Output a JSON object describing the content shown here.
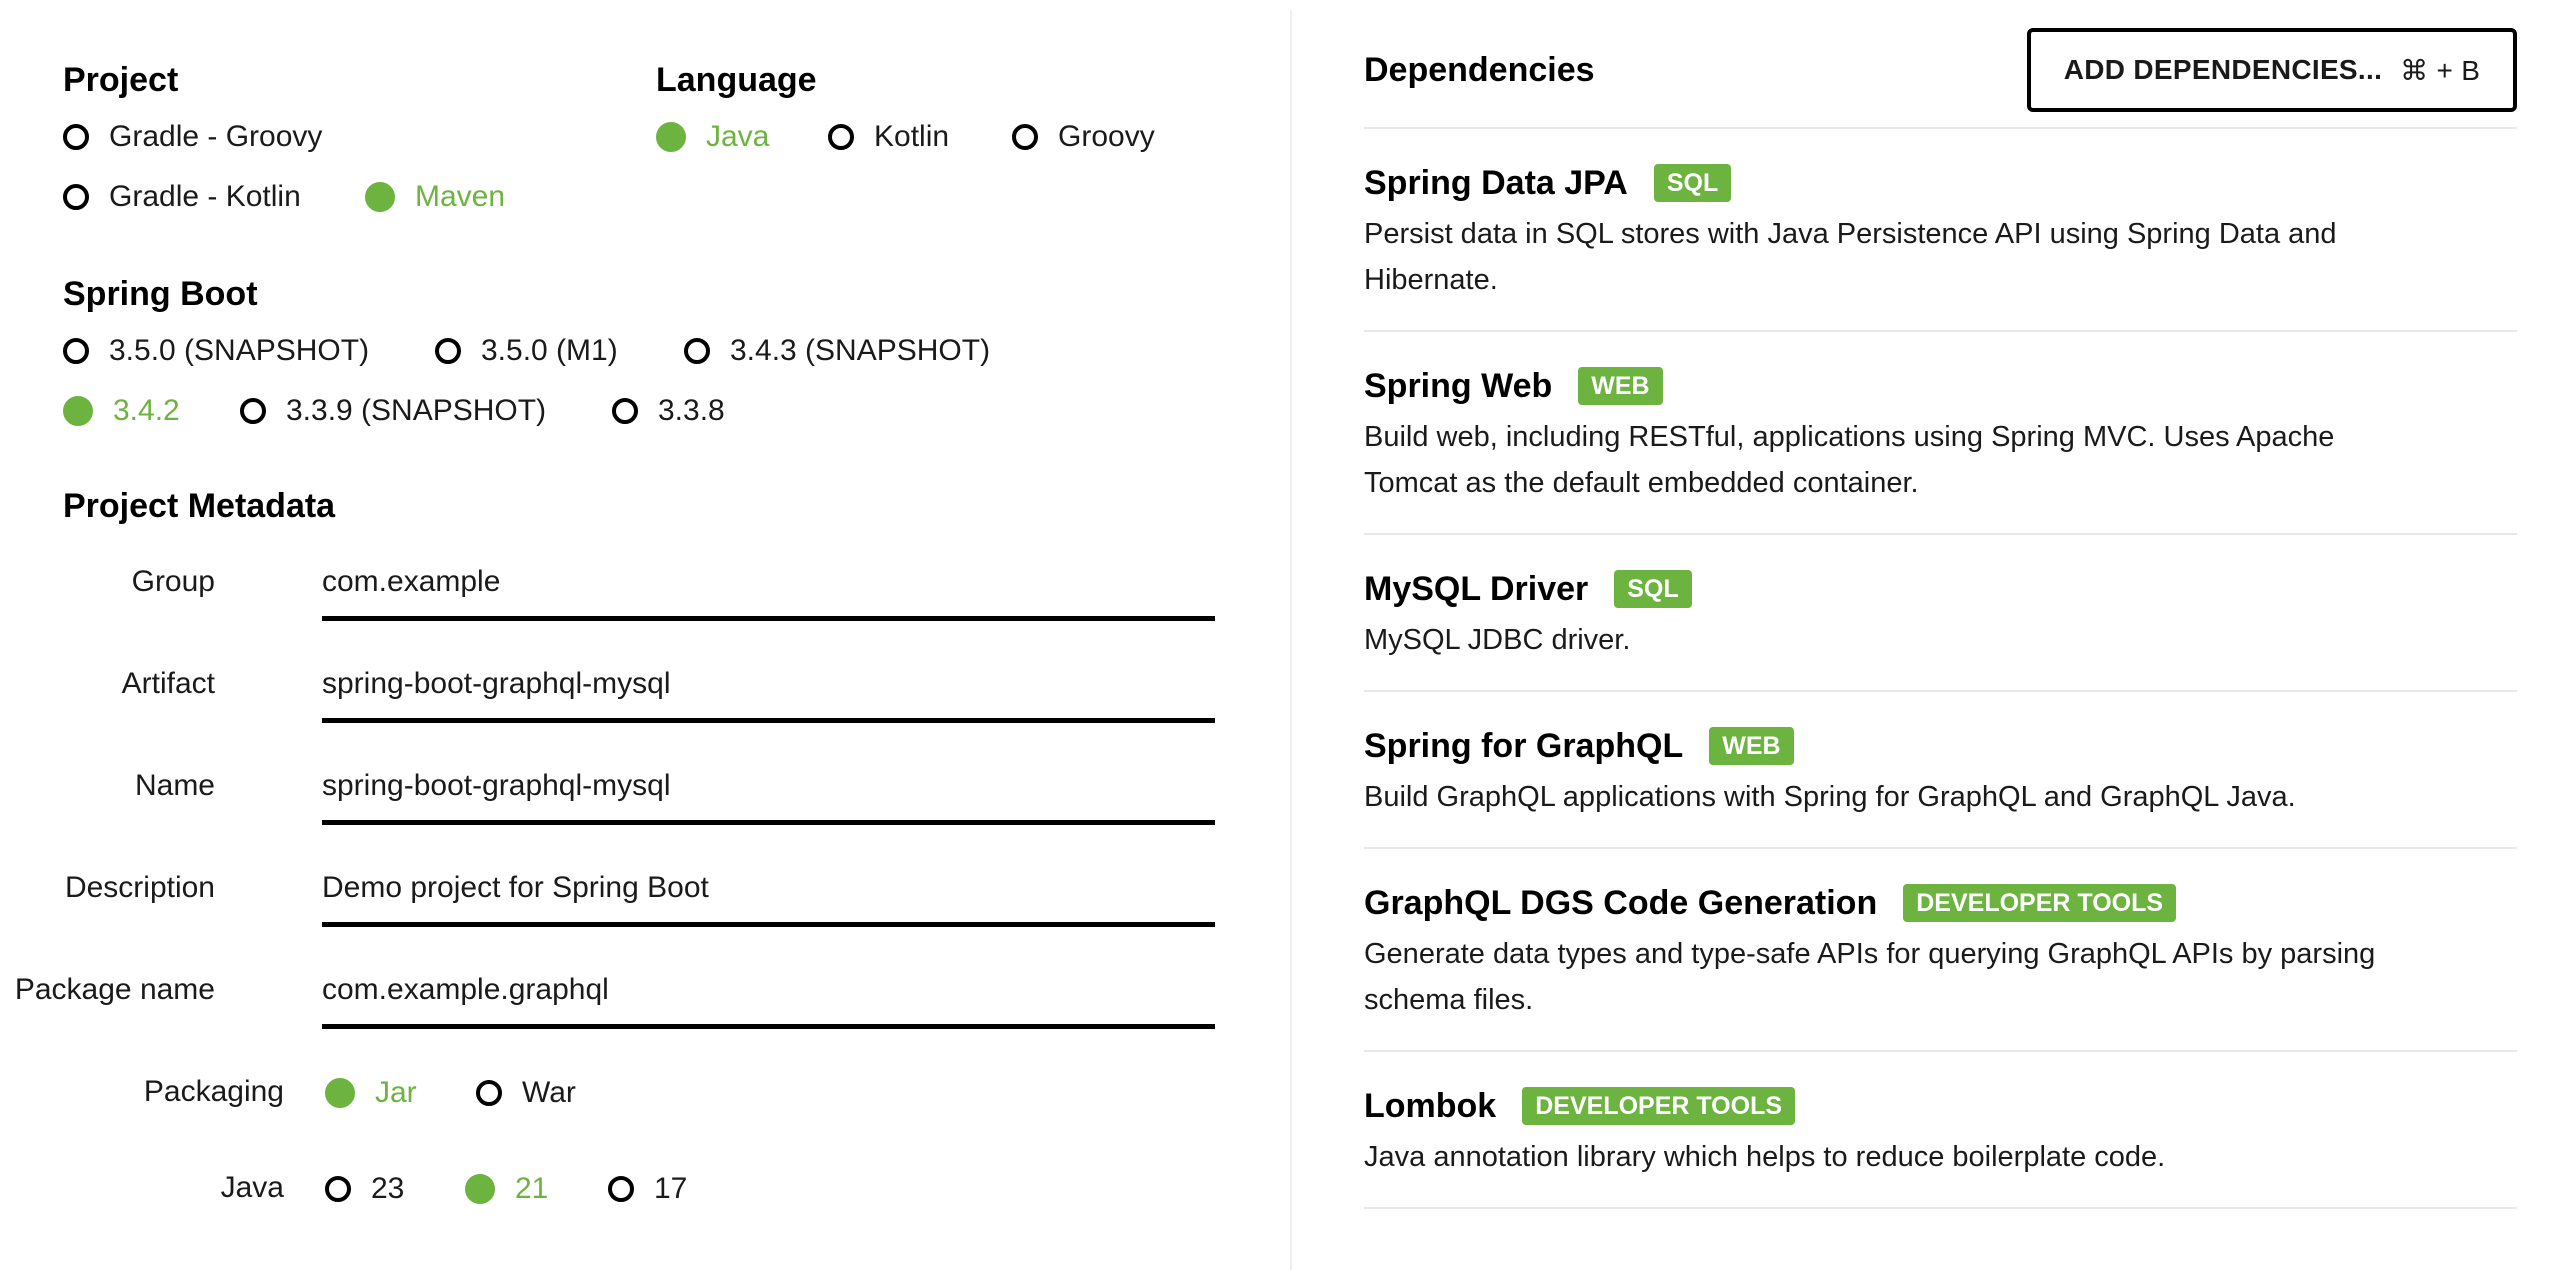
{
  "project": {
    "title": "Project",
    "options": [
      "Gradle - Groovy",
      "Gradle - Kotlin",
      "Maven"
    ],
    "selected": "Maven"
  },
  "language": {
    "title": "Language",
    "options": [
      "Java",
      "Kotlin",
      "Groovy"
    ],
    "selected": "Java"
  },
  "spring_boot": {
    "title": "Spring Boot",
    "options": [
      "3.5.0 (SNAPSHOT)",
      "3.5.0 (M1)",
      "3.4.3 (SNAPSHOT)",
      "3.4.2",
      "3.3.9 (SNAPSHOT)",
      "3.3.8"
    ],
    "selected": "3.4.2"
  },
  "metadata": {
    "title": "Project Metadata",
    "fields": [
      {
        "label": "Group",
        "value": "com.example"
      },
      {
        "label": "Artifact",
        "value": "spring-boot-graphql-mysql"
      },
      {
        "label": "Name",
        "value": "spring-boot-graphql-mysql"
      },
      {
        "label": "Description",
        "value": "Demo project for Spring Boot"
      },
      {
        "label": "Package name",
        "value": "com.example.graphql"
      }
    ],
    "packaging": {
      "label": "Packaging",
      "options": [
        "Jar",
        "War"
      ],
      "selected": "Jar"
    },
    "java": {
      "label": "Java",
      "options": [
        "23",
        "21",
        "17"
      ],
      "selected": "21"
    }
  },
  "dependencies": {
    "title": "Dependencies",
    "add_button": {
      "label": "ADD DEPENDENCIES...",
      "shortcut": "⌘ + B"
    },
    "items": [
      {
        "name": "Spring Data JPA",
        "tag": "SQL",
        "description": "Persist data in SQL stores with Java Persistence API using Spring Data and Hibernate."
      },
      {
        "name": "Spring Web",
        "tag": "WEB",
        "description": "Build web, including RESTful, applications using Spring MVC. Uses Apache Tomcat as the default embedded container."
      },
      {
        "name": "MySQL Driver",
        "tag": "SQL",
        "description": "MySQL JDBC driver."
      },
      {
        "name": "Spring for GraphQL",
        "tag": "WEB",
        "description": "Build GraphQL applications with Spring for GraphQL and GraphQL Java."
      },
      {
        "name": "GraphQL DGS Code Generation",
        "tag": "DEVELOPER TOOLS",
        "description": "Generate data types and type-safe APIs for querying GraphQL APIs by parsing schema files."
      },
      {
        "name": "Lombok",
        "tag": "DEVELOPER TOOLS",
        "description": "Java annotation library which helps to reduce boilerplate code."
      }
    ]
  },
  "colors": {
    "accent": "#6db33f",
    "text": "#1a1a1a",
    "divider": "#eef0f0"
  }
}
